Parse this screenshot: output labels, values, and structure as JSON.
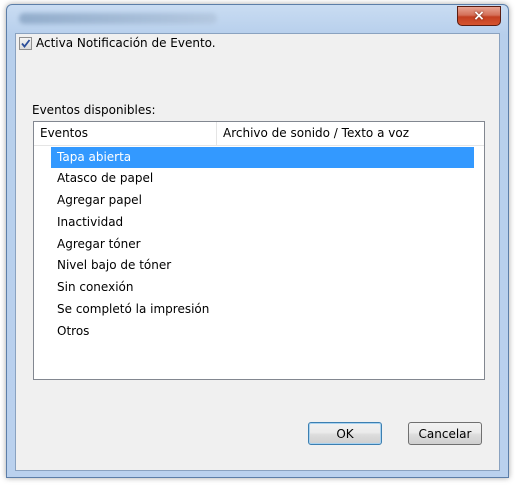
{
  "window": {
    "title_blurred": "",
    "close_glyph": "×"
  },
  "notification": {
    "checkbox_checked": true,
    "checkbox_label": "Activa Notificación de Evento."
  },
  "events_group": {
    "label": "Eventos disponibles:",
    "columns": [
      "Eventos",
      "Archivo de sonido / Texto a voz"
    ],
    "rows": [
      {
        "event": "Tapa abierta",
        "sound": "",
        "selected": true
      },
      {
        "event": "Atasco de papel",
        "sound": "",
        "selected": false
      },
      {
        "event": "Agregar papel",
        "sound": "",
        "selected": false
      },
      {
        "event": "Inactividad",
        "sound": "",
        "selected": false
      },
      {
        "event": "Agregar tóner",
        "sound": "",
        "selected": false
      },
      {
        "event": "Nivel bajo de tóner",
        "sound": "",
        "selected": false
      },
      {
        "event": "Sin conexión",
        "sound": "",
        "selected": false
      },
      {
        "event": "Se completó la impresión",
        "sound": "",
        "selected": false
      },
      {
        "event": "Otros",
        "sound": "",
        "selected": false
      }
    ]
  },
  "buttons": {
    "ok": "OK",
    "cancel": "Cancelar"
  },
  "colors": {
    "selection": "#3399ff",
    "close_button": "#c33f21",
    "frame": "#b7cfec"
  }
}
